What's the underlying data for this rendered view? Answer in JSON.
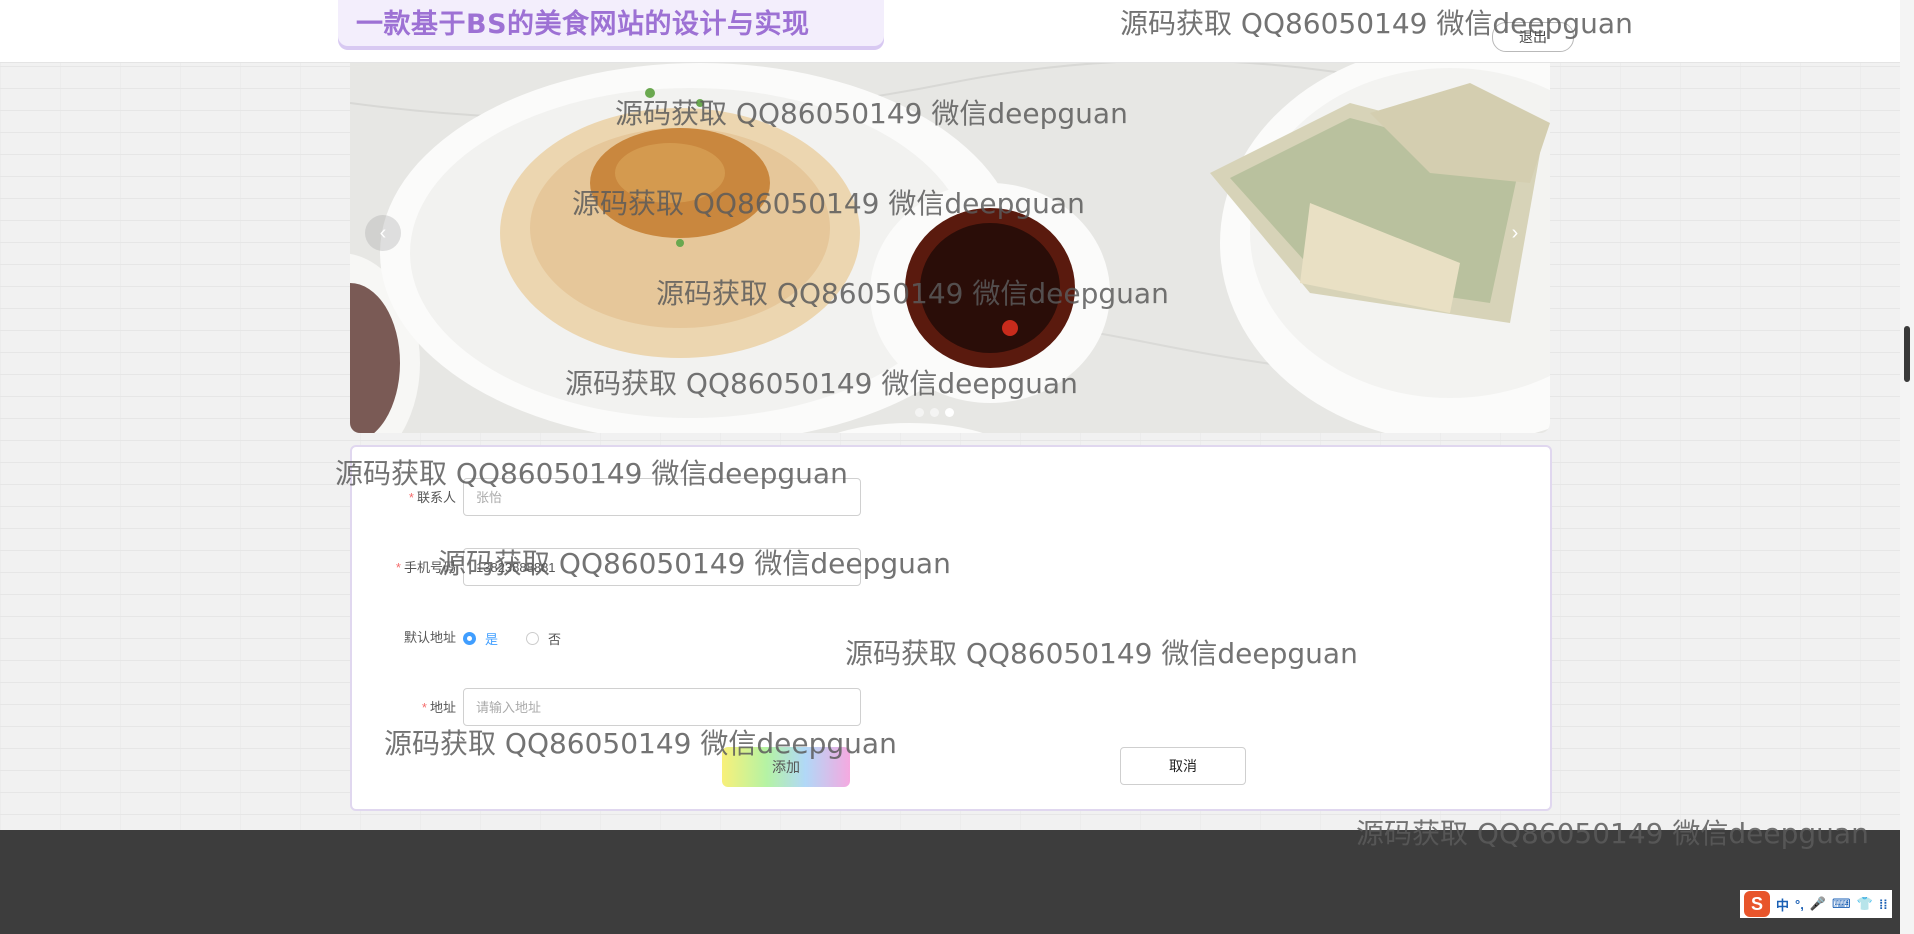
{
  "header": {
    "site_title": "一款基于BS的美食网站的设计与实现",
    "logout_label": "退出"
  },
  "carousel": {
    "prev_symbol": "‹",
    "next_symbol": "›",
    "slide_count": 3,
    "active_slide": 3
  },
  "form": {
    "contact_label": "联系人",
    "contact_value": "张怡",
    "phone_label": "手机号码",
    "phone_value": "13823888881",
    "default_label": "默认地址",
    "default_options": [
      "是",
      "否"
    ],
    "default_selected": "是",
    "address_label": "地址",
    "address_placeholder": "请输入地址",
    "required_mark": "*",
    "add_button": "添加",
    "cancel_button": "取消"
  },
  "watermark_text": "源码获取 QQ86050149 微信deepguan",
  "ime": {
    "logo": "S",
    "items": [
      "中",
      "°,",
      "🎤",
      "⌨",
      "👕",
      "⁞⁞"
    ]
  }
}
